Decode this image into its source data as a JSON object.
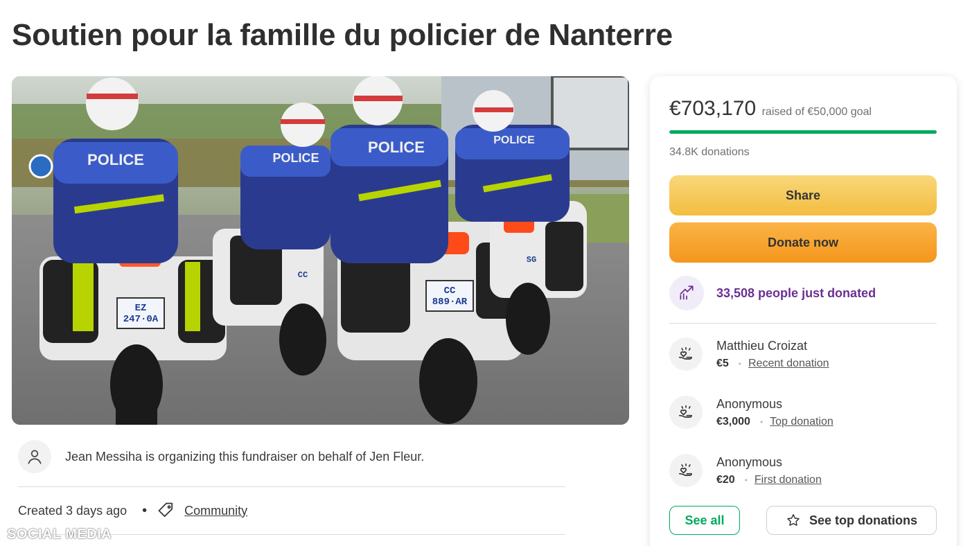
{
  "page": {
    "title": "Soutien pour la famille du policier de Nanterre"
  },
  "hero": {
    "jacket_labels": [
      "POLICE",
      "POLICE",
      "POLICE",
      "POLICE"
    ],
    "plates": [
      "EZ\n247·0A",
      "CC\n889·AR",
      "CC",
      "SG"
    ]
  },
  "organizer": {
    "text": "Jean Messiha is organizing this fundraiser on behalf of Jen Fleur.",
    "icon": "person-icon"
  },
  "meta": {
    "created": "Created 3 days ago",
    "separator": "•",
    "category": "Community",
    "icon": "tag-icon"
  },
  "watermark": "SOCIAL MEDIA",
  "card": {
    "amount": "€703,170",
    "goal_text": "raised of €50,000 goal",
    "progress_fraction": 1.0,
    "donations_count": "34.8K donations",
    "share_label": "Share",
    "donate_label": "Donate now",
    "trend_text": "33,508 people just donated",
    "donors": [
      {
        "name": "Matthieu Croizat",
        "amount": "€5",
        "type": "Recent donation"
      },
      {
        "name": "Anonymous",
        "amount": "€3,000",
        "type": "Top donation"
      },
      {
        "name": "Anonymous",
        "amount": "€20",
        "type": "First donation"
      }
    ],
    "see_all_label": "See all",
    "see_top_label": "See top donations"
  },
  "colors": {
    "accent_green": "#02a95c",
    "share_yellow": "#f3bd40",
    "donate_orange": "#f4961d",
    "trend_purple": "#6b2f93"
  }
}
